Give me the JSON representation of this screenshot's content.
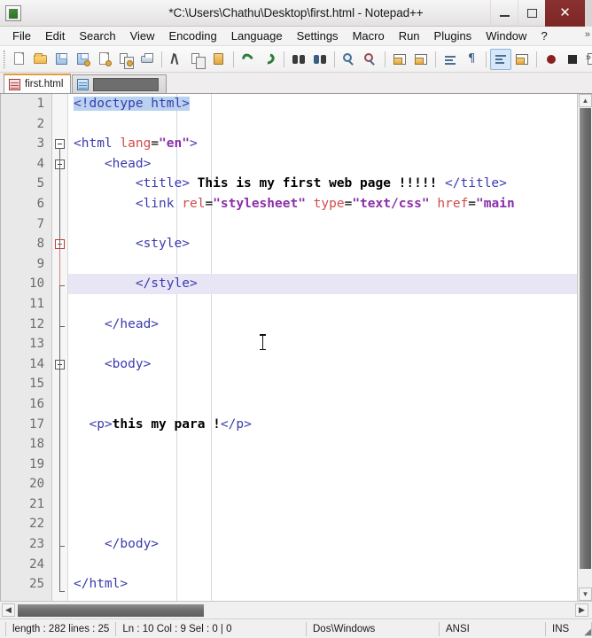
{
  "window": {
    "title": "*C:\\Users\\Chathu\\Desktop\\first.html - Notepad++",
    "icon": "notepad-plus-plus-icon",
    "controls": {
      "minimize": "–",
      "maximize": "☐",
      "close": "✕"
    },
    "close_color": "#8a3030"
  },
  "menubar": {
    "items": [
      {
        "label": "File"
      },
      {
        "label": "Edit"
      },
      {
        "label": "Search"
      },
      {
        "label": "View"
      },
      {
        "label": "Encoding"
      },
      {
        "label": "Language"
      },
      {
        "label": "Settings"
      },
      {
        "label": "Macro"
      },
      {
        "label": "Run"
      },
      {
        "label": "Plugins"
      },
      {
        "label": "Window"
      },
      {
        "label": "?"
      }
    ],
    "overflow": "»"
  },
  "toolbar": {
    "overflow": "»",
    "buttons": [
      {
        "name": "new-file-icon",
        "kind": "doc"
      },
      {
        "name": "open-file-icon",
        "kind": "folder"
      },
      {
        "name": "save-icon",
        "kind": "floppy"
      },
      {
        "name": "save-all-icon",
        "kind": "floppy-all"
      },
      {
        "name": "close-file-icon",
        "kind": "doc-close"
      },
      {
        "name": "close-all-files-icon",
        "kind": "doc-close-all"
      },
      {
        "name": "print-icon",
        "kind": "printer"
      },
      {
        "name": "separator",
        "kind": "sep"
      },
      {
        "name": "cut-icon",
        "kind": "scissors"
      },
      {
        "name": "copy-icon",
        "kind": "stack"
      },
      {
        "name": "paste-icon",
        "kind": "clipboard"
      },
      {
        "name": "separator",
        "kind": "sep"
      },
      {
        "name": "undo-icon",
        "kind": "undo"
      },
      {
        "name": "redo-icon",
        "kind": "redo"
      },
      {
        "name": "separator",
        "kind": "sep"
      },
      {
        "name": "find-icon",
        "kind": "binoculars"
      },
      {
        "name": "replace-icon",
        "kind": "replace"
      },
      {
        "name": "separator",
        "kind": "sep"
      },
      {
        "name": "zoom-in-icon",
        "kind": "magnify-in"
      },
      {
        "name": "zoom-out-icon",
        "kind": "magnify-out"
      },
      {
        "name": "separator",
        "kind": "sep"
      },
      {
        "name": "sync-vertical-scroll-icon",
        "kind": "winsplit"
      },
      {
        "name": "sync-horizontal-scroll-icon",
        "kind": "winsplit"
      },
      {
        "name": "separator",
        "kind": "sep"
      },
      {
        "name": "word-wrap-icon",
        "kind": "wrap"
      },
      {
        "name": "show-all-characters-icon",
        "kind": "paragraph"
      },
      {
        "name": "separator",
        "kind": "sep"
      },
      {
        "name": "indent-guideline-icon",
        "kind": "indentguide",
        "pressed": true
      },
      {
        "name": "user-defined-dialog-icon",
        "kind": "winsplit"
      },
      {
        "name": "separator",
        "kind": "sep"
      },
      {
        "name": "record-macro-icon",
        "kind": "rec-dot"
      },
      {
        "name": "stop-macro-icon",
        "kind": "rec-square"
      },
      {
        "name": "play-macro-icon",
        "kind": "rec-play"
      }
    ]
  },
  "tabs": [
    {
      "label": "first.html",
      "icon": "red-document-icon",
      "active": true
    },
    {
      "label": "",
      "icon": "blue-document-icon",
      "active": false,
      "obscured": true
    }
  ],
  "editor": {
    "total_lines": 25,
    "current_line": 10,
    "lines": [
      {
        "n": 1,
        "fold": null,
        "current": false,
        "tokens": [
          {
            "t": "doctype",
            "s": "<!doctype html>"
          }
        ]
      },
      {
        "n": 2,
        "fold": null,
        "current": false,
        "tokens": []
      },
      {
        "n": 3,
        "fold": "open",
        "current": false,
        "tokens": [
          {
            "t": "tag",
            "s": "<html "
          },
          {
            "t": "attr",
            "s": "lang"
          },
          {
            "t": "plain",
            "s": "="
          },
          {
            "t": "val",
            "s": "\"en\""
          },
          {
            "t": "tag",
            "s": ">"
          }
        ]
      },
      {
        "n": 4,
        "fold": "open",
        "current": false,
        "tokens": [
          {
            "t": "plain",
            "s": "    "
          },
          {
            "t": "tag",
            "s": "<head>"
          }
        ]
      },
      {
        "n": 5,
        "fold": null,
        "current": false,
        "tokens": [
          {
            "t": "plain",
            "s": "        "
          },
          {
            "t": "tag",
            "s": "<title>"
          },
          {
            "t": "text",
            "s": " This is my first web page !!!!! "
          },
          {
            "t": "tag",
            "s": "</title>"
          }
        ]
      },
      {
        "n": 6,
        "fold": null,
        "current": false,
        "tokens": [
          {
            "t": "plain",
            "s": "        "
          },
          {
            "t": "tag",
            "s": "<link "
          },
          {
            "t": "attr",
            "s": "rel"
          },
          {
            "t": "plain",
            "s": "="
          },
          {
            "t": "val",
            "s": "\"stylesheet\""
          },
          {
            "t": "plain",
            "s": " "
          },
          {
            "t": "attr",
            "s": "type"
          },
          {
            "t": "plain",
            "s": "="
          },
          {
            "t": "val",
            "s": "\"text/css\""
          },
          {
            "t": "plain",
            "s": " "
          },
          {
            "t": "attr",
            "s": "href"
          },
          {
            "t": "plain",
            "s": "="
          },
          {
            "t": "val",
            "s": "\"main"
          }
        ]
      },
      {
        "n": 7,
        "fold": null,
        "current": false,
        "tokens": []
      },
      {
        "n": 8,
        "fold": "open-hot",
        "current": false,
        "tokens": [
          {
            "t": "plain",
            "s": "        "
          },
          {
            "t": "tag",
            "s": "<style>"
          }
        ]
      },
      {
        "n": 9,
        "fold": null,
        "current": false,
        "tokens": []
      },
      {
        "n": 10,
        "fold": null,
        "current": true,
        "tokens": [
          {
            "t": "plain",
            "s": "        "
          },
          {
            "t": "tag",
            "s": "</style>"
          }
        ]
      },
      {
        "n": 11,
        "fold": null,
        "current": false,
        "tokens": []
      },
      {
        "n": 12,
        "fold": null,
        "current": false,
        "tokens": [
          {
            "t": "plain",
            "s": "    "
          },
          {
            "t": "tag",
            "s": "</head>"
          }
        ]
      },
      {
        "n": 13,
        "fold": null,
        "current": false,
        "tokens": []
      },
      {
        "n": 14,
        "fold": "open",
        "current": false,
        "tokens": [
          {
            "t": "plain",
            "s": "    "
          },
          {
            "t": "tag",
            "s": "<body>"
          }
        ]
      },
      {
        "n": 15,
        "fold": null,
        "current": false,
        "tokens": []
      },
      {
        "n": 16,
        "fold": null,
        "current": false,
        "tokens": []
      },
      {
        "n": 17,
        "fold": null,
        "current": false,
        "tokens": [
          {
            "t": "plain",
            "s": "  "
          },
          {
            "t": "tag",
            "s": "<p>"
          },
          {
            "t": "text",
            "s": "this my para !"
          },
          {
            "t": "tag",
            "s": "</p>"
          }
        ]
      },
      {
        "n": 18,
        "fold": null,
        "current": false,
        "tokens": []
      },
      {
        "n": 19,
        "fold": null,
        "current": false,
        "tokens": []
      },
      {
        "n": 20,
        "fold": null,
        "current": false,
        "tokens": []
      },
      {
        "n": 21,
        "fold": null,
        "current": false,
        "tokens": []
      },
      {
        "n": 22,
        "fold": null,
        "current": false,
        "tokens": []
      },
      {
        "n": 23,
        "fold": null,
        "current": false,
        "tokens": [
          {
            "t": "plain",
            "s": "    "
          },
          {
            "t": "tag",
            "s": "</body>"
          }
        ]
      },
      {
        "n": 24,
        "fold": null,
        "current": false,
        "tokens": []
      },
      {
        "n": 25,
        "fold": null,
        "current": false,
        "tokens": [
          {
            "t": "tag",
            "s": "</html>"
          }
        ]
      }
    ]
  },
  "scrollbars": {
    "vertical_up": "▲",
    "vertical_down": "▼",
    "horizontal_left": "◀",
    "horizontal_right": "▶"
  },
  "statusbar": {
    "length_lines": "length : 282    lines : 25",
    "position": "Ln : 10    Col : 9    Sel : 0 | 0",
    "eol": "Dos\\Windows",
    "encoding": "ANSI",
    "insert_mode": "INS",
    "corner": "◢"
  }
}
